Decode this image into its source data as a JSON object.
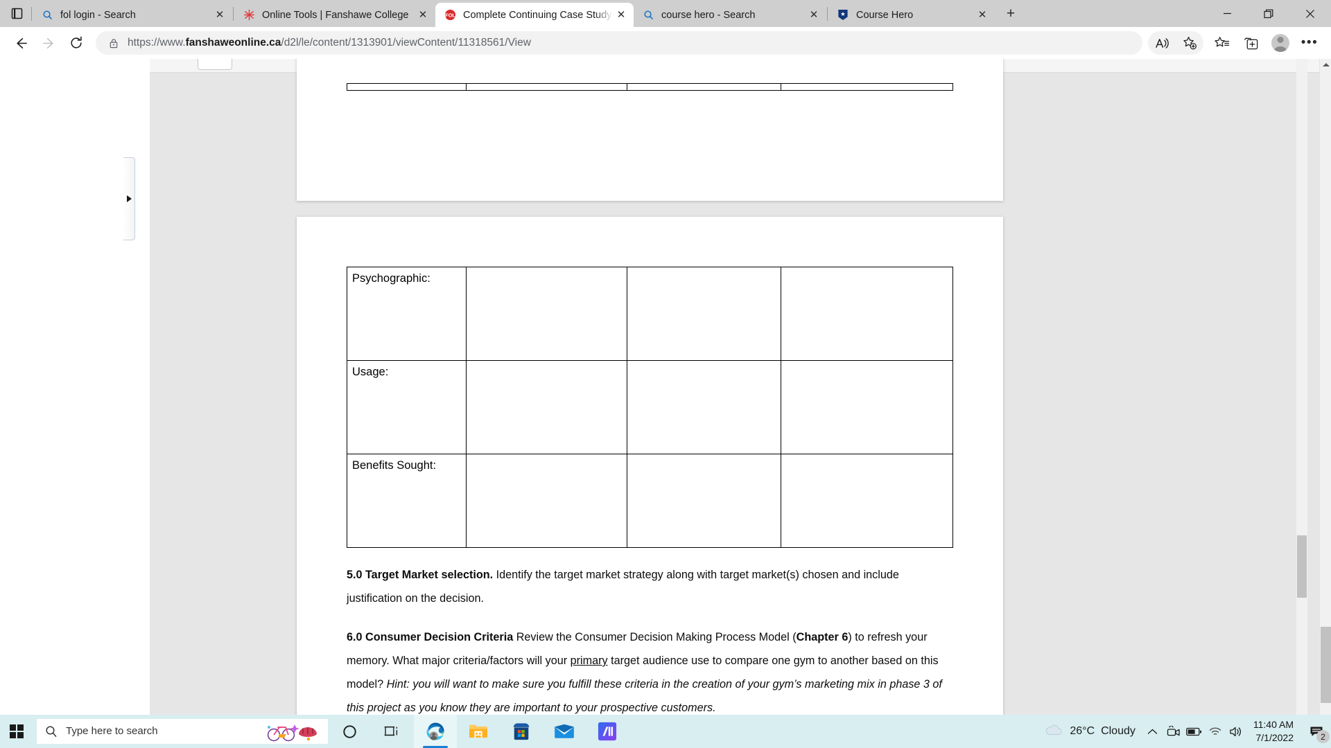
{
  "browser": {
    "name": "Microsoft Edge",
    "tab_list_icon": "tab-list-icon",
    "new_tab_label": "+",
    "tabs": [
      {
        "title": "fol login - Search",
        "favicon": "bing-search-icon",
        "active": false,
        "close_label": "✕"
      },
      {
        "title": "Online Tools | Fanshawe College",
        "favicon": "fanshawe-icon",
        "active": false,
        "close_label": "✕"
      },
      {
        "title": "Complete Continuing Case Study",
        "favicon": "fol-icon",
        "active": true,
        "close_label": "✕"
      },
      {
        "title": "course hero - Search",
        "favicon": "bing-search-icon",
        "active": false,
        "close_label": "✕"
      },
      {
        "title": "Course Hero",
        "favicon": "course-hero-icon",
        "active": false,
        "close_label": "✕"
      }
    ],
    "window_controls": {
      "minimize": "—",
      "restore": "❐",
      "close": "✕"
    },
    "nav": {
      "back": "back-arrow-icon",
      "forward": "forward-arrow-icon",
      "refresh": "refresh-icon",
      "lock": "lock-icon"
    },
    "address": {
      "scheme": "https://www.",
      "domain": "fanshaweonline.ca",
      "path": "/d2l/le/content/1313901/viewContent/11318561/View",
      "full_url": "https://www.fanshaweonline.ca/d2l/le/content/1313901/viewContent/11318561/View"
    },
    "toolbar": {
      "read_aloud": "read-aloud-icon",
      "add_favorite": "add-favorite-icon",
      "favorites": "favorites-icon",
      "collections": "collections-icon",
      "profile": "profile-avatar",
      "settings": "more-options-icon"
    }
  },
  "page": {
    "panel_handle": "▶",
    "document": {
      "table": {
        "columns": [
          "segment-label",
          "segment-1",
          "segment-2",
          "segment-3"
        ],
        "rows": [
          {
            "label": "Psychographic:",
            "cells": [
              "",
              "",
              ""
            ]
          },
          {
            "label": "Usage:",
            "cells": [
              "",
              "",
              ""
            ]
          },
          {
            "label": "Benefits Sought:",
            "cells": [
              "",
              "",
              ""
            ]
          }
        ]
      },
      "sections": [
        {
          "id": "section-5",
          "heading": "5.0 Target Market selection.",
          "body": "  Identify the target market strategy along with target market(s) chosen and include justification on the decision."
        },
        {
          "id": "section-6",
          "heading": "6.0 Consumer Decision Criteria",
          "body_part_1": "   Review the Consumer Decision Making Process Model (",
          "bold_inline": "Chapter 6",
          "body_part_2": ") to refresh your memory.  What major criteria/factors will your ",
          "underlined_inline": "primary",
          "body_part_3": " target audience use to compare one gym to another based on this model? ",
          "italic_hint": " Hint: you will want to make sure you fulfill these criteria in the creation of your gym’s marketing mix in phase 3 of this project as you know they are important to your prospective customers."
        }
      ]
    }
  },
  "taskbar": {
    "start": "windows-start-icon",
    "search_placeholder": "Type here to search",
    "search_icon": "magnifier-icon",
    "bing_daily_image": "bicycle-helmet-illustration",
    "items": [
      {
        "name": "cortana",
        "icon": "cortana-circle-icon",
        "active": false
      },
      {
        "name": "task-view",
        "icon": "task-view-icon",
        "active": false
      },
      {
        "name": "microsoft-edge",
        "icon": "edge-icon",
        "active": true
      },
      {
        "name": "file-explorer",
        "icon": "file-explorer-icon",
        "active": false
      },
      {
        "name": "microsoft-store",
        "icon": "microsoft-store-icon",
        "active": false
      },
      {
        "name": "mail",
        "icon": "mail-icon",
        "active": false
      },
      {
        "name": "media-app",
        "icon": "media-app-icon",
        "active": false
      }
    ],
    "tray": {
      "weather_icon": "cloud-icon",
      "temperature": "26°C",
      "condition": "Cloudy",
      "show_hidden": "chevron-up-icon",
      "camera": "camera-icon",
      "battery": "battery-icon",
      "network": "wifi-icon",
      "volume": "volume-icon",
      "time": "11:40 AM",
      "date": "7/1/2022",
      "notifications_icon": "notifications-icon",
      "notifications_count": "2"
    }
  }
}
